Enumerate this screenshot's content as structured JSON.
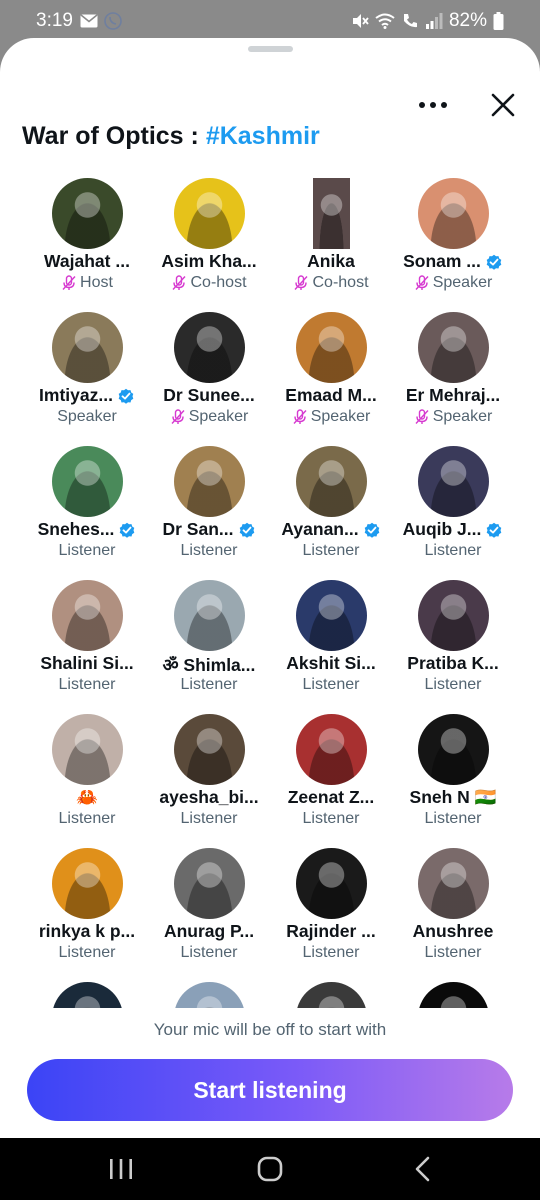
{
  "status_bar": {
    "time": "3:19",
    "battery": "82%"
  },
  "space": {
    "title_prefix": "War of Optics : ",
    "title_hashtag": "#Kashmir"
  },
  "participants": [
    {
      "name": "Wajahat ...",
      "role": "Host",
      "muted": true,
      "verified": false,
      "avatar_color": "#3a4a2a"
    },
    {
      "name": "Asim Kha...",
      "role": "Co-host",
      "muted": true,
      "verified": false,
      "avatar_color": "#e6c21a"
    },
    {
      "name": "Anika",
      "role": "Co-host",
      "muted": true,
      "verified": false,
      "avatar_color": "#5a4a4a"
    },
    {
      "name": "Sonam ...",
      "role": "Speaker",
      "muted": true,
      "verified": true,
      "avatar_color": "#d99070"
    },
    {
      "name": "Imtiyaz...",
      "role": "Speaker",
      "muted": false,
      "verified": true,
      "avatar_color": "#8a7a5a"
    },
    {
      "name": "Dr Sunee...",
      "role": "Speaker",
      "muted": true,
      "verified": false,
      "avatar_color": "#2a2a2a"
    },
    {
      "name": "Emaad M...",
      "role": "Speaker",
      "muted": true,
      "verified": false,
      "avatar_color": "#c07a30"
    },
    {
      "name": "Er Mehraj...",
      "role": "Speaker",
      "muted": true,
      "verified": false,
      "avatar_color": "#6a5a5a"
    },
    {
      "name": "Snehes...",
      "role": "Listener",
      "muted": false,
      "verified": true,
      "avatar_color": "#4a8a5a"
    },
    {
      "name": "Dr San...",
      "role": "Listener",
      "muted": false,
      "verified": true,
      "avatar_color": "#a08050"
    },
    {
      "name": "Ayanan...",
      "role": "Listener",
      "muted": false,
      "verified": true,
      "avatar_color": "#7a6a4a"
    },
    {
      "name": "Auqib J...",
      "role": "Listener",
      "muted": false,
      "verified": true,
      "avatar_color": "#3a3a5a"
    },
    {
      "name": "Shalini Si...",
      "role": "Listener",
      "muted": false,
      "verified": false,
      "avatar_color": "#b09080"
    },
    {
      "name": "ॐ Shimla...",
      "role": "Listener",
      "muted": false,
      "verified": false,
      "avatar_color": "#9aa8b0"
    },
    {
      "name": "Akshit Si...",
      "role": "Listener",
      "muted": false,
      "verified": false,
      "avatar_color": "#2a3a6a"
    },
    {
      "name": "Pratiba K...",
      "role": "Listener",
      "muted": false,
      "verified": false,
      "avatar_color": "#4a3a4a"
    },
    {
      "name": "🦀",
      "role": "Listener",
      "muted": false,
      "verified": false,
      "avatar_color": "#c0b0a8"
    },
    {
      "name": "ayesha_bi...",
      "role": "Listener",
      "muted": false,
      "verified": false,
      "avatar_color": "#5a4a3a"
    },
    {
      "name": "Zeenat Z...",
      "role": "Listener",
      "muted": false,
      "verified": false,
      "avatar_color": "#a83030"
    },
    {
      "name": "Sneh N 🇮🇳",
      "role": "Listener",
      "muted": false,
      "verified": false,
      "avatar_color": "#151515"
    },
    {
      "name": "rinkya k p...",
      "role": "Listener",
      "muted": false,
      "verified": false,
      "avatar_color": "#e0901a"
    },
    {
      "name": "Anurag P...",
      "role": "Listener",
      "muted": false,
      "verified": false,
      "avatar_color": "#6a6a6a"
    },
    {
      "name": "Rajinder ...",
      "role": "Listener",
      "muted": false,
      "verified": false,
      "avatar_color": "#1a1a1a"
    },
    {
      "name": "Anushree",
      "role": "Listener",
      "muted": false,
      "verified": false,
      "avatar_color": "#7a6a6a"
    },
    {
      "name": "",
      "role": "",
      "muted": false,
      "verified": false,
      "avatar_color": "#1a2a3a"
    },
    {
      "name": "",
      "role": "",
      "muted": false,
      "verified": false,
      "avatar_color": "#8aa0b8"
    },
    {
      "name": "",
      "role": "",
      "muted": false,
      "verified": false,
      "avatar_color": "#3a3a3a"
    },
    {
      "name": "",
      "role": "",
      "muted": false,
      "verified": false,
      "avatar_color": "#0a0a0a"
    }
  ],
  "footer": {
    "mic_note": "Your mic will be off to start with",
    "start_label": "Start listening"
  },
  "colors": {
    "accent": "#1d9bf0",
    "mic_off": "#d63ad0",
    "gradient_start": "#3b44f6",
    "gradient_end": "#b77be9"
  }
}
